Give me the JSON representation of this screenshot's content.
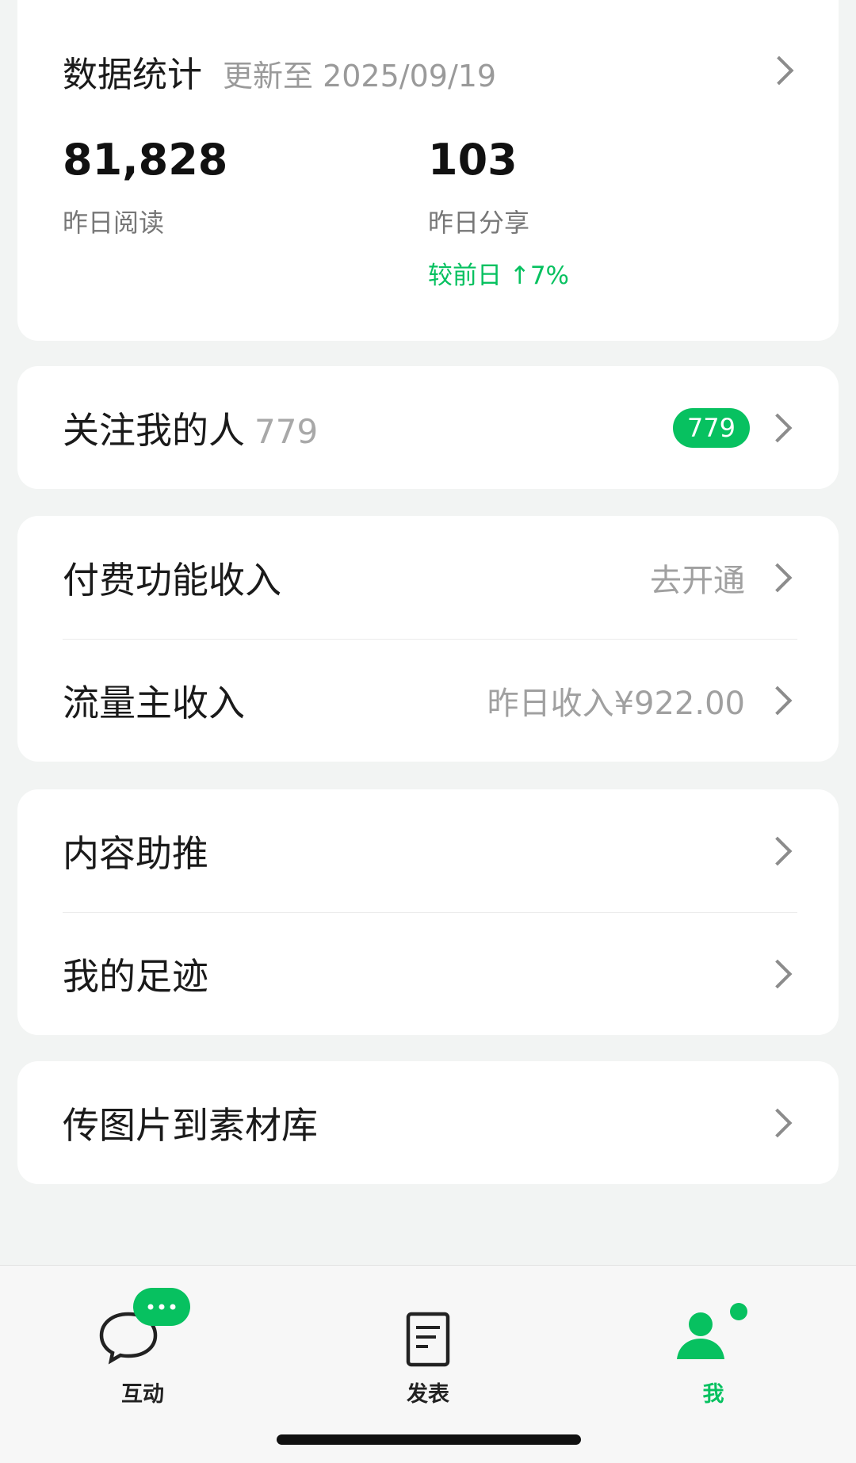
{
  "stats": {
    "title": "数据统计",
    "updated": "更新至 2025/09/19",
    "reads_value": "81,828",
    "reads_label": "昨日阅读",
    "shares_value": "103",
    "shares_label": "昨日分享",
    "shares_change": "较前日 ↑7%"
  },
  "followers": {
    "label": "关注我的人",
    "count": "779",
    "badge": "779"
  },
  "income": {
    "paid_label": "付费功能收入",
    "paid_action": "去开通",
    "ads_label": "流量主收入",
    "ads_value": "昨日收入¥922.00"
  },
  "tools": {
    "promote_label": "内容助推",
    "footprint_label": "我的足迹"
  },
  "upload": {
    "label": "传图片到素材库"
  },
  "tabbar": {
    "interact": "互动",
    "publish": "发表",
    "me": "我"
  },
  "colors": {
    "accent": "#07c160",
    "background": "#f2f4f3"
  }
}
